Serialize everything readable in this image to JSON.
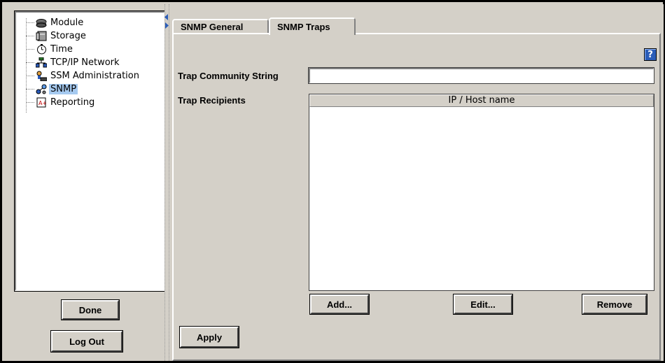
{
  "tree": {
    "items": [
      {
        "label": "Module",
        "icon": "module-icon"
      },
      {
        "label": "Storage",
        "icon": "storage-icon"
      },
      {
        "label": "Time",
        "icon": "clock-icon"
      },
      {
        "label": "TCP/IP Network",
        "icon": "network-icon"
      },
      {
        "label": "SSM Administration",
        "icon": "admin-icon"
      },
      {
        "label": "SNMP",
        "icon": "snmp-icon",
        "selected": true
      },
      {
        "label": "Reporting",
        "icon": "report-icon"
      }
    ]
  },
  "left_buttons": {
    "done": "Done",
    "logout": "Log Out"
  },
  "tabs": [
    {
      "label": "SNMP General",
      "active": false
    },
    {
      "label": "SNMP Traps",
      "active": true
    }
  ],
  "help": {
    "label": "?"
  },
  "form": {
    "community_label": "Trap Community String",
    "community_value": "",
    "recipients_label": "Trap Recipients",
    "recipients_column": "IP / Host name",
    "recipients_rows": []
  },
  "actions": {
    "add": "Add...",
    "edit": "Edit...",
    "remove": "Remove",
    "apply": "Apply"
  },
  "colors": {
    "panel": "#d4d0c8",
    "selection": "#a6caf0",
    "help_blue": "#2b5db8"
  }
}
